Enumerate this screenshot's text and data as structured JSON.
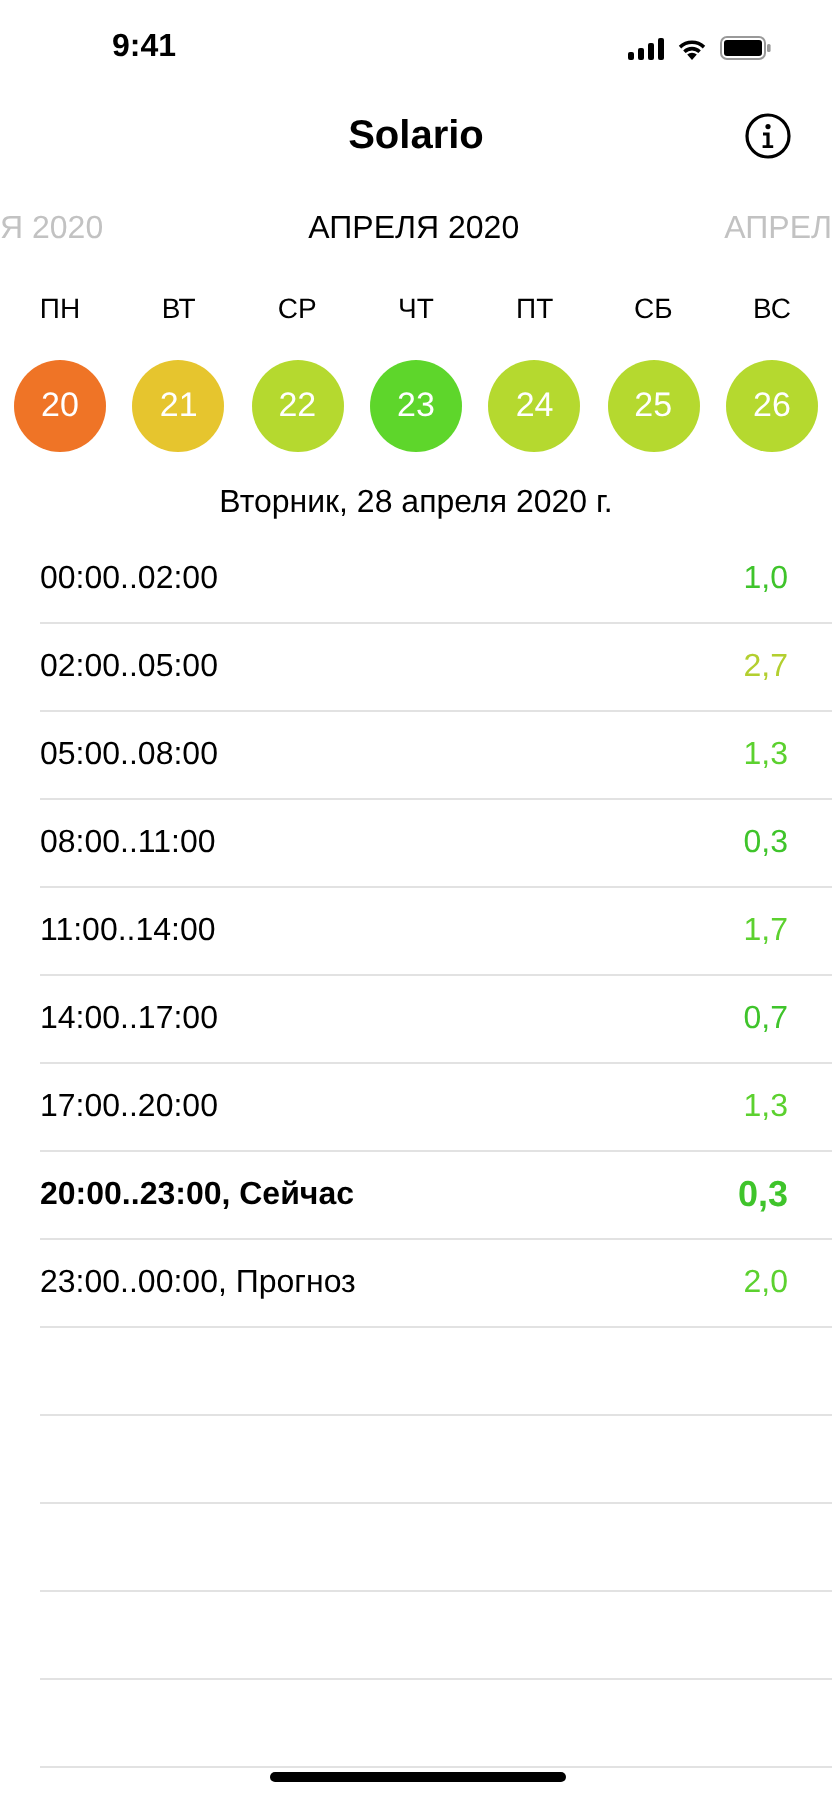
{
  "status_bar": {
    "time": "9:41"
  },
  "nav": {
    "title": "Solario"
  },
  "months": [
    {
      "label": "Я 2020",
      "selected": false
    },
    {
      "label": "АПРЕЛЯ 2020",
      "selected": true
    },
    {
      "label": "АПРЕЛ",
      "selected": false
    }
  ],
  "week": [
    {
      "weekday": "ПН",
      "day": "20",
      "color": "#ef7426"
    },
    {
      "weekday": "ВТ",
      "day": "21",
      "color": "#e6c52e"
    },
    {
      "weekday": "СР",
      "day": "22",
      "color": "#b5d92f"
    },
    {
      "weekday": "ЧТ",
      "day": "23",
      "color": "#5ed62b"
    },
    {
      "weekday": "ПТ",
      "day": "24",
      "color": "#b5d92f"
    },
    {
      "weekday": "СБ",
      "day": "25",
      "color": "#b5d92f"
    },
    {
      "weekday": "ВС",
      "day": "26",
      "color": "#b5d92f"
    }
  ],
  "date_heading": "Вторник, 28 апреля 2020 г.",
  "rows": [
    {
      "time": "00:00..02:00",
      "value": "1,0",
      "color": "#3fc42b",
      "current": false
    },
    {
      "time": "02:00..05:00",
      "value": "2,7",
      "color": "#b3cf2f",
      "current": false
    },
    {
      "time": "05:00..08:00",
      "value": "1,3",
      "color": "#5cd12f",
      "current": false
    },
    {
      "time": "08:00..11:00",
      "value": "0,3",
      "color": "#3fc42b",
      "current": false
    },
    {
      "time": "11:00..14:00",
      "value": "1,7",
      "color": "#5cd12f",
      "current": false
    },
    {
      "time": "14:00..17:00",
      "value": "0,7",
      "color": "#3fc42b",
      "current": false
    },
    {
      "time": "17:00..20:00",
      "value": "1,3",
      "color": "#5cd12f",
      "current": false
    },
    {
      "time": "20:00..23:00, Сейчас",
      "value": "0,3",
      "color": "#3fc42b",
      "current": true
    },
    {
      "time": "23:00..00:00, Прогноз",
      "value": "2,0",
      "color": "#5cd12f",
      "current": false
    }
  ]
}
